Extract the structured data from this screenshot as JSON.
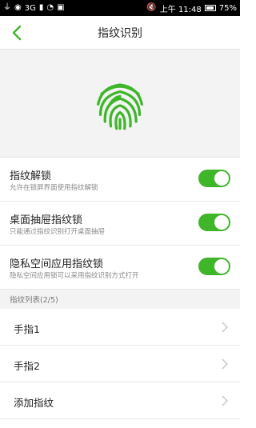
{
  "statusbar": {
    "network": "3G",
    "mute_icon": "mute-icon",
    "time": "上午 11:48",
    "battery": "75%",
    "battery_level": 0.75
  },
  "header": {
    "title": "指纹识别",
    "back_icon": "back-arrow-icon"
  },
  "hero": {
    "icon": "fingerprint-icon",
    "accent_color": "#3fb52a"
  },
  "settings": [
    {
      "title": "指纹解锁",
      "subtitle": "允许在锁屏界面使用指纹解锁",
      "enabled": true
    },
    {
      "title": "桌面抽屉指纹锁",
      "subtitle": "只能通过指纹识别打开桌面抽屉",
      "enabled": true
    },
    {
      "title": "隐私空间应用指纹锁",
      "subtitle": "隐私空间应用锁可以采用指纹识别方式打开",
      "enabled": true
    }
  ],
  "fingerprint_list": {
    "header": "指纹列表(2/5)",
    "items": [
      {
        "label": "手指1"
      },
      {
        "label": "手指2"
      },
      {
        "label": "添加指纹"
      }
    ]
  }
}
